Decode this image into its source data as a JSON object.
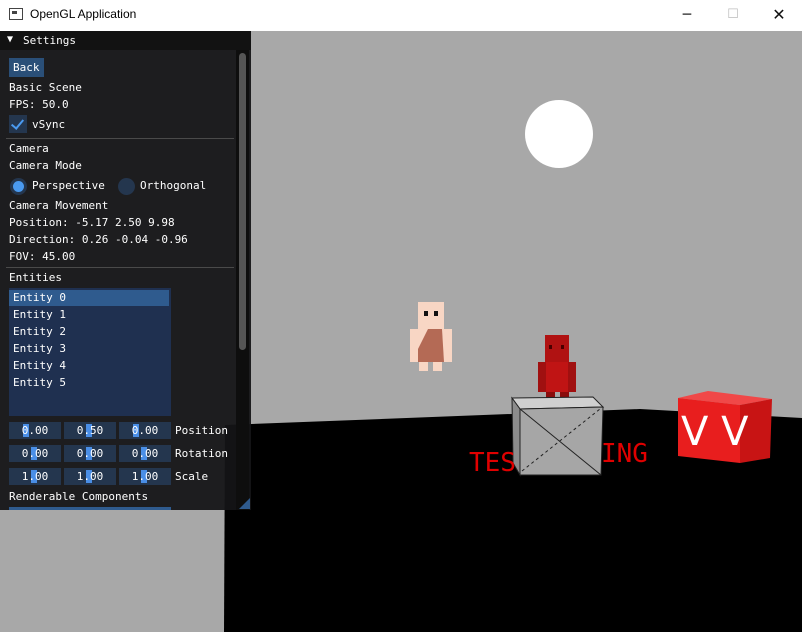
{
  "window": {
    "title": "OpenGL Application",
    "minimize": "─",
    "maximize": "☐",
    "close": "✕"
  },
  "panel": {
    "header": "Settings",
    "back_label": "Back",
    "scene_name": "Basic Scene",
    "fps": "FPS: 50.0",
    "vsync_label": "vSync",
    "vsync_checked": true,
    "camera_section": "Camera",
    "camera_mode_label": "Camera Mode",
    "mode_perspective": "Perspective",
    "mode_orthogonal": "Orthogonal",
    "selected_mode": "Perspective",
    "camera_movement": "Camera Movement",
    "position": "Position: -5.17 2.50 9.98",
    "direction": "Direction: 0.26 -0.04 -0.96",
    "fov": "FOV: 45.00",
    "entities_section": "Entities",
    "entities": [
      "Entity 0",
      "Entity 1",
      "Entity 2",
      "Entity 3",
      "Entity 4",
      "Entity 5"
    ],
    "selected_entity": "Entity 0",
    "transform": {
      "position": {
        "label": "Position",
        "values": [
          "0.00",
          "0.50",
          "0.00"
        ]
      },
      "rotation": {
        "label": "Rotation",
        "values": [
          "0.00",
          "0.00",
          "0.00"
        ]
      },
      "scale": {
        "label": "Scale",
        "values": [
          "1.00",
          "1.00",
          "1.00"
        ]
      }
    },
    "renderable_components": "Renderable Components"
  },
  "scene": {
    "text_left": "TES",
    "text_right": "ING",
    "cube_text": "V V",
    "colors": {
      "background": "#a8a8a8",
      "floor": "#000000",
      "sun": "#ffffff",
      "red_text": "#e00000",
      "red_cube": "#e81e1e",
      "crate": "#a3a3a3"
    }
  },
  "ui_colors": {
    "panel_bg": "#141416",
    "accent": "#4a9af0",
    "button": "#2a4f78",
    "selection": "#2f5b8e"
  }
}
